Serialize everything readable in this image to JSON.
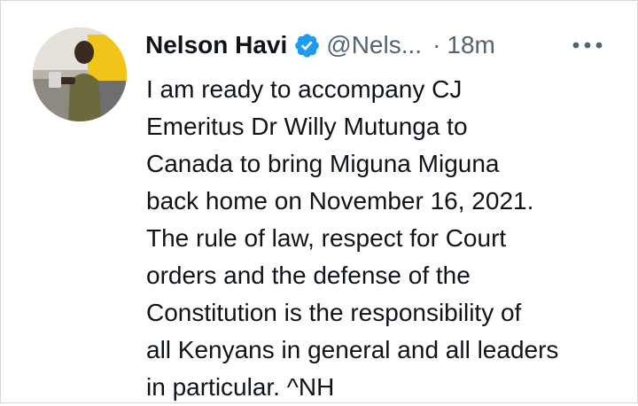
{
  "tweet": {
    "author": {
      "display_name": "Nelson Havi",
      "handle": "@Nels...",
      "verified": true,
      "avatar_icon": "profile-photo"
    },
    "separator": "·",
    "timestamp": "18m",
    "more_icon": "more-horizontal-icon",
    "text": "I am ready to accompany CJ\nEmeritus Dr Willy Mutunga to\nCanada to bring Miguna Miguna\nback home on November 16, 2021.\nThe rule of law, respect for Court\norders and the defense of the\nConstitution is the responsibility of\nall Kenyans in general and all leaders\nin particular. ^NH"
  },
  "colors": {
    "text_primary": "#0f1419",
    "text_secondary": "#536471",
    "verified_blue": "#1d9bf0",
    "background": "#ffffff"
  }
}
